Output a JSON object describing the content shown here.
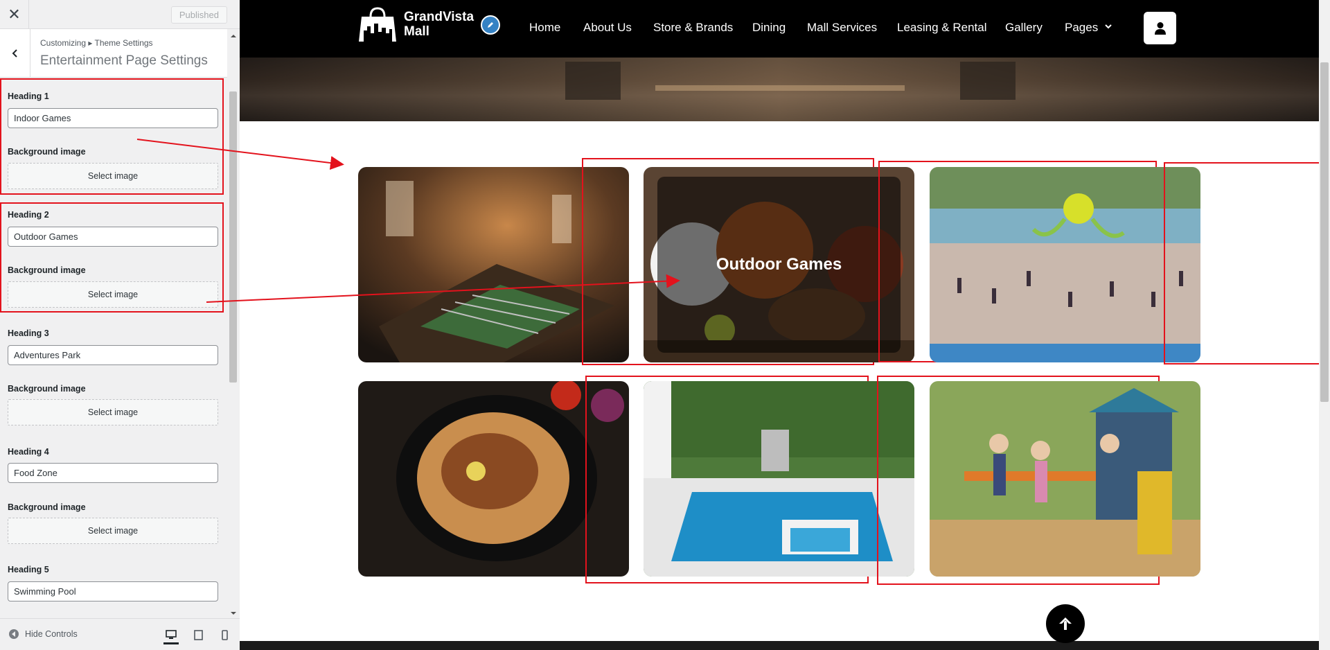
{
  "customizer": {
    "close_label": "✕",
    "publish_label": "Published",
    "breadcrumb": "Customizing ▸ Theme Settings",
    "section_title": "Entertainment Page Settings",
    "hide_controls_label": "Hide Controls",
    "fields": [
      {
        "heading_label": "Heading 1",
        "value": "Indoor Games",
        "bg_label": "Background image",
        "button_label": "Select image"
      },
      {
        "heading_label": "Heading 2",
        "value": "Outdoor Games",
        "bg_label": "Background image",
        "button_label": "Select image"
      },
      {
        "heading_label": "Heading 3",
        "value": "Adventures Park",
        "bg_label": "Background image",
        "button_label": "Select image"
      },
      {
        "heading_label": "Heading 4",
        "value": "Food Zone",
        "bg_label": "Background image",
        "button_label": "Select image"
      },
      {
        "heading_label": "Heading 5",
        "value": "Swimming Pool"
      }
    ]
  },
  "site": {
    "brand_line1": "GrandVista",
    "brand_line2": "Mall",
    "nav": [
      "Home",
      "About Us",
      "Store & Brands",
      "Dining",
      "Mall Services",
      "Leasing & Rental",
      "Gallery",
      "Pages"
    ]
  },
  "gallery": {
    "hover_label": "Outdoor Games",
    "tiles": [
      "foosball-table",
      "sports-balls",
      "water-park",
      "biryani-plate",
      "swimming-pool",
      "kids-playground"
    ]
  },
  "colors": {
    "annotation": "#e3121c",
    "nav_bg": "#000000",
    "customizer_bg": "#f0f0f1",
    "edit_shortcut": "#3582c4"
  }
}
